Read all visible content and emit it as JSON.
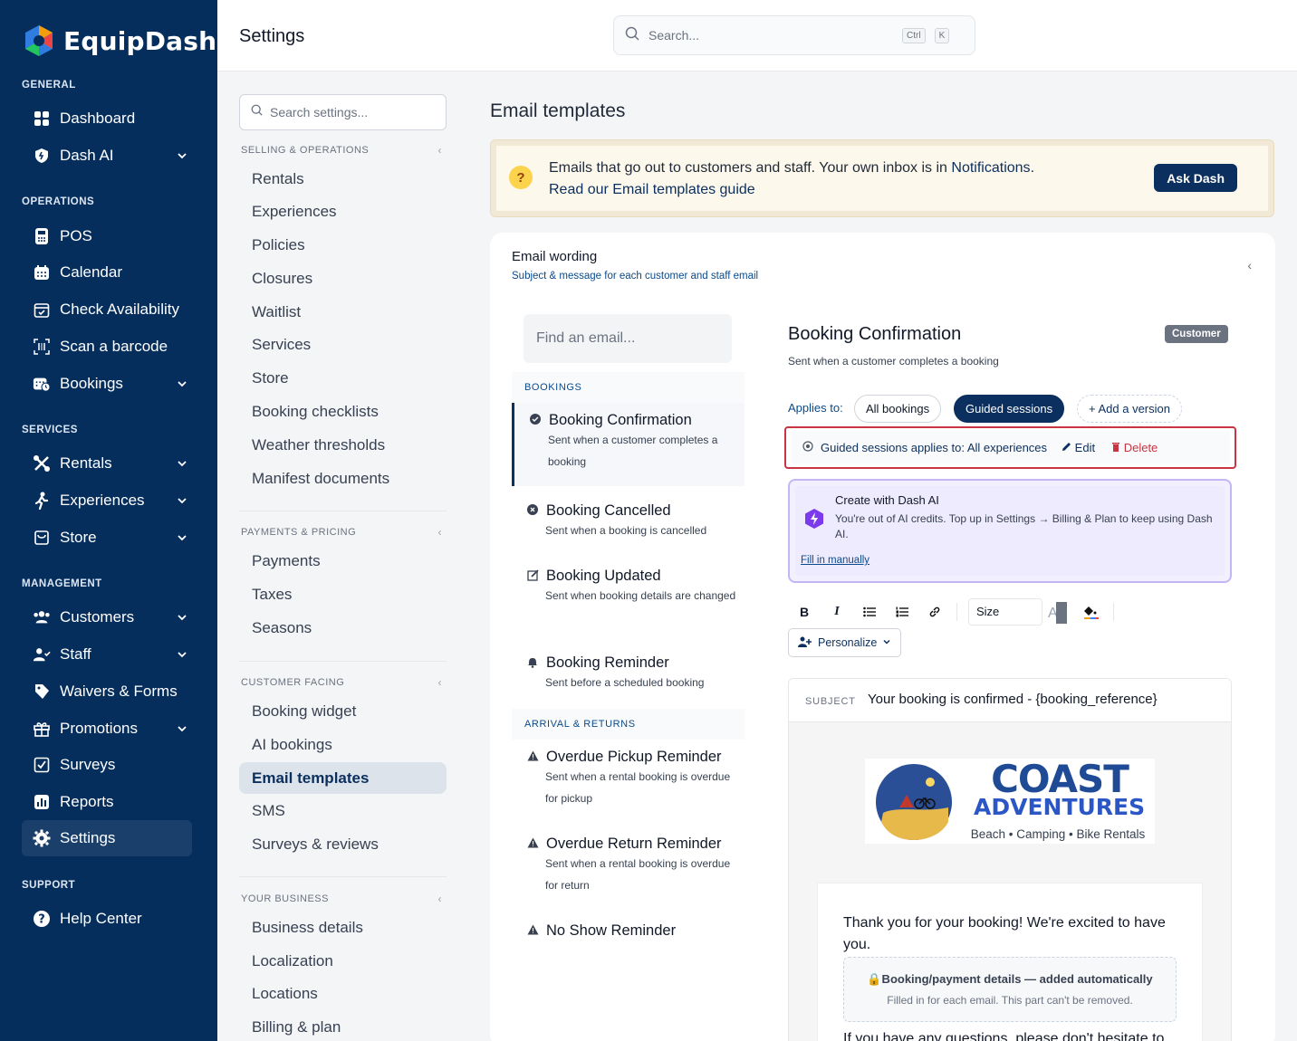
{
  "brand": {
    "name": "EquipDash"
  },
  "sidebar": {
    "sections": {
      "general": "GENERAL",
      "operations": "OPERATIONS",
      "services": "SERVICES",
      "management": "MANAGEMENT",
      "support": "SUPPORT"
    },
    "items": [
      {
        "label": "Dashboard",
        "icon": "grid-icon"
      },
      {
        "label": "Dash AI",
        "icon": "shield-ai-icon"
      },
      {
        "label": "POS",
        "icon": "pos-terminal-icon"
      },
      {
        "label": "Calendar",
        "icon": "calendar-icon"
      },
      {
        "label": "Check Availability",
        "icon": "calendar-check-icon"
      },
      {
        "label": "Scan a barcode",
        "icon": "barcode-scan-icon"
      },
      {
        "label": "Bookings",
        "icon": "bookings-icon"
      },
      {
        "label": "Rentals",
        "icon": "rentals-icon"
      },
      {
        "label": "Experiences",
        "icon": "experiences-icon"
      },
      {
        "label": "Store",
        "icon": "store-icon"
      },
      {
        "label": "Customers",
        "icon": "customers-icon"
      },
      {
        "label": "Staff",
        "icon": "staff-icon"
      },
      {
        "label": "Waivers & Forms",
        "icon": "waiver-tag-icon"
      },
      {
        "label": "Promotions",
        "icon": "gift-icon"
      },
      {
        "label": "Surveys",
        "icon": "survey-check-icon"
      },
      {
        "label": "Reports",
        "icon": "reports-icon"
      },
      {
        "label": "Settings",
        "icon": "gear-icon"
      },
      {
        "label": "Help Center",
        "icon": "help-icon"
      }
    ]
  },
  "topbar": {
    "title": "Settings",
    "search_placeholder": "Search...",
    "kbd_ctrl": "Ctrl",
    "kbd_k": "K"
  },
  "settings_nav": {
    "search_placeholder": "Search settings...",
    "groups": [
      {
        "label": "SELLING & OPERATIONS",
        "items": [
          "Rentals",
          "Experiences",
          "Policies",
          "Closures",
          "Waitlist",
          "Services",
          "Store",
          "Booking checklists",
          "Weather thresholds",
          "Manifest documents"
        ]
      },
      {
        "label": "PAYMENTS & PRICING",
        "items": [
          "Payments",
          "Taxes",
          "Seasons"
        ]
      },
      {
        "label": "CUSTOMER FACING",
        "items": [
          "Booking widget",
          "AI bookings",
          "Email templates",
          "SMS",
          "Surveys & reviews"
        ]
      },
      {
        "label": "YOUR BUSINESS",
        "items": [
          "Business details",
          "Localization",
          "Locations",
          "Billing & plan"
        ]
      }
    ],
    "active": "Email templates"
  },
  "main": {
    "title": "Email templates",
    "banner": {
      "text": "Emails that go out to customers and staff. Your own inbox is in ",
      "link": "Notifications",
      "period": ".",
      "guide": "Read our Email templates guide",
      "button": "Ask Dash"
    },
    "card": {
      "title": "Email wording",
      "subtitle": "Subject & message for each customer and staff email",
      "find_placeholder": "Find an email...",
      "groups": {
        "bookings": "BOOKINGS",
        "arrival": "ARRIVAL & RETURNS"
      },
      "emails": [
        {
          "title": "Booking Confirmation",
          "desc": "Sent when a customer completes a booking",
          "icon": "check-circle-icon"
        },
        {
          "title": "Booking Cancelled",
          "desc": "Sent when a booking is cancelled",
          "icon": "x-circle-icon"
        },
        {
          "title": "Booking Updated",
          "desc": "Sent when booking details are changed",
          "icon": "edit-icon"
        },
        {
          "title": "Booking Reminder",
          "desc": "Sent before a scheduled booking",
          "icon": "bell-icon"
        },
        {
          "title": "Overdue Pickup Reminder",
          "desc": "Sent when a rental booking is overdue for pickup",
          "icon": "warning-icon"
        },
        {
          "title": "Overdue Return Reminder",
          "desc": "Sent when a rental booking is overdue for return",
          "icon": "warning-icon"
        },
        {
          "title": "No Show Reminder",
          "desc": "",
          "icon": "warning-icon"
        }
      ],
      "detail": {
        "title": "Booking Confirmation",
        "subtitle": "Sent when a customer completes a booking",
        "badge": "Customer",
        "applies_label": "Applies to:",
        "pills": [
          "All bookings",
          "Guided sessions",
          "+ Add a version"
        ],
        "rule": {
          "text": "Guided sessions applies to: All experiences",
          "edit": "Edit",
          "delete": "Delete"
        },
        "ai": {
          "title": "Create with Dash AI",
          "desc": "You're out of AI credits. Top up in Settings → Billing & Plan to keep using Dash AI.",
          "fill": "Fill in manually"
        },
        "toolbar": {
          "size": "Size"
        },
        "personalize": "Personalize",
        "subject_label": "SUBJECT",
        "subject_value": "Your booking is confirmed - {booking_reference}",
        "logo": {
          "line1": "COAST",
          "line2": "ADVENTURES",
          "tagline": "Beach • Camping • Bike Rentals"
        },
        "body_p1": "Thank you for your booking! We're excited to have you.",
        "auto_title": "🔒Booking/payment details — added automatically",
        "auto_desc": "Filled in for each email. This part can't be removed.",
        "body_p2": "If you have any questions, please don't hesitate to"
      }
    }
  }
}
